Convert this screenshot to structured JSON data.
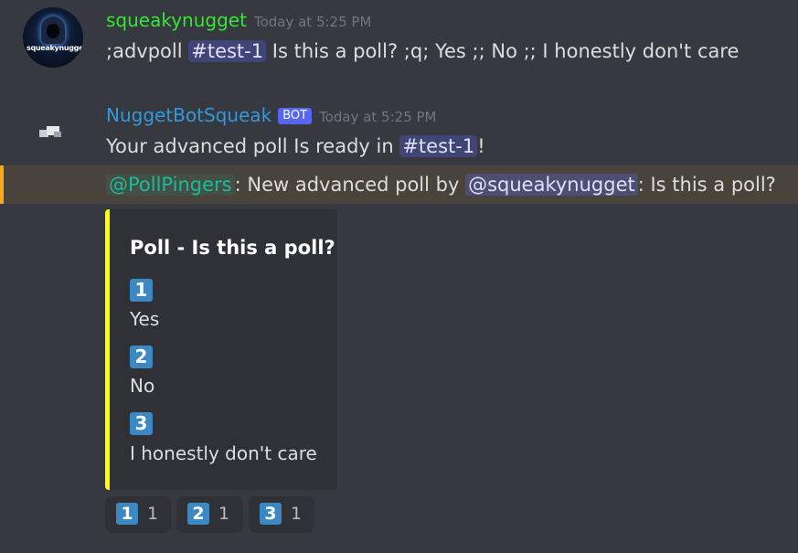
{
  "messages": [
    {
      "username": "squeakynugget",
      "username_color": "#35e635",
      "timestamp": "Today at 5:25 PM",
      "avatar_text": "squeakynugget",
      "content": {
        "prefix": ";advpoll ",
        "channel": "#test-1",
        "suffix": " Is this a poll? ;q; Yes ;; No ;; I honestly don't care"
      }
    },
    {
      "username": "NuggetBotSqueak",
      "username_color": "#3498db",
      "bot_tag": "BOT",
      "timestamp": "Today at 5:25 PM",
      "line1": {
        "prefix": "Your advanced poll Is ready in ",
        "channel": "#test-1",
        "suffix": "!"
      },
      "line2": {
        "role_mention": "@PollPingers",
        "middle": ": New advanced poll by ",
        "user_mention": "@squeakynugget",
        "suffix": ": Is this a poll?"
      },
      "embed": {
        "accent_color": "#ffff00",
        "title": "Poll - Is this a poll?",
        "options": [
          {
            "number": "1",
            "text": "Yes"
          },
          {
            "number": "2",
            "text": "No"
          },
          {
            "number": "3",
            "text": "I honestly don't care"
          }
        ]
      },
      "reactions": [
        {
          "emoji": "1",
          "count": "1"
        },
        {
          "emoji": "2",
          "count": "1"
        },
        {
          "emoji": "3",
          "count": "1"
        }
      ]
    }
  ],
  "colors": {
    "background": "#36393f",
    "embed_background": "#2f3136",
    "mention_highlight": "#faa81a",
    "keycap_blue": "#3b88c3",
    "bot_tag": "#5865f2"
  }
}
